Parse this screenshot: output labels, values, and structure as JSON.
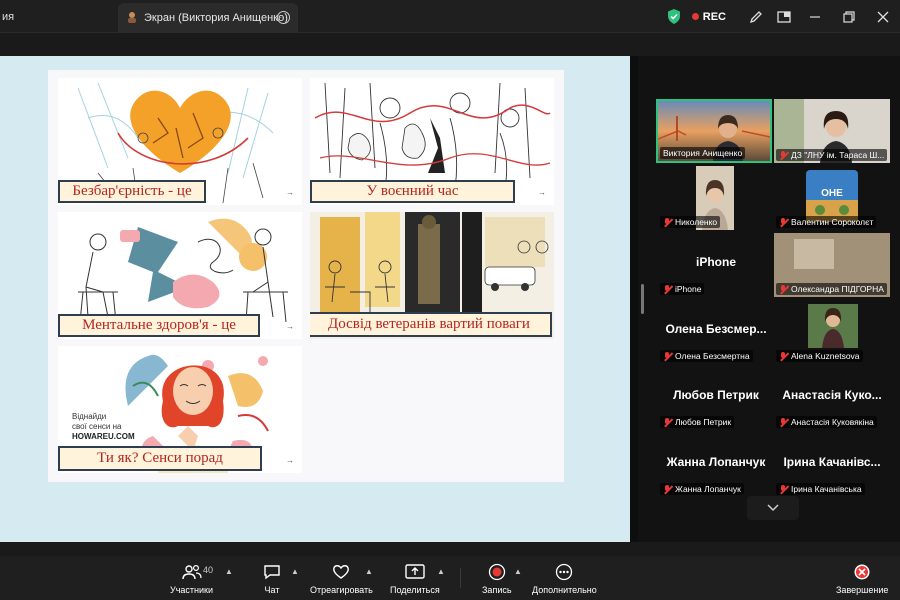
{
  "app": {
    "prev_tab_fragment": "ия",
    "active_tab_title": "Экран (Виктория Анищенко)",
    "rec_label": "REC"
  },
  "slide": {
    "cards": [
      {
        "label": "Безбар'єрність - це"
      },
      {
        "label": "У воєнний час"
      },
      {
        "label": "Ментальне здоров'я - це"
      },
      {
        "label": "Досвід ветеранів вартий поваги"
      },
      {
        "label": "Ти як? Сенси порад"
      }
    ],
    "howareu_line1": "Віднайди",
    "howareu_line2": "свої сенси на",
    "howareu_site": "HOWAREU.COM",
    "arrow": "→"
  },
  "participants": [
    {
      "tag": "Виктория Анищенко",
      "muted": false
    },
    {
      "tag": "ДЗ \"ЛНУ ім. Тараса Ш...",
      "muted": true
    },
    {
      "tag": "Николенко",
      "muted": true
    },
    {
      "tag": "Валентин Сороколєт",
      "muted": true
    },
    {
      "big": "iPhone",
      "tag": "iPhone",
      "muted": true
    },
    {
      "tag": "Олександра ПІДГОРНА",
      "muted": true
    },
    {
      "big": "Олена  Безсмер...",
      "tag": "Олена Безсмертна",
      "muted": true
    },
    {
      "tag": "Alena Kuznetsova",
      "muted": true
    },
    {
      "big": "Любов Петрик",
      "tag": "Любов Петрик",
      "muted": true
    },
    {
      "big": "Анастасія  Куко...",
      "tag": "Анастасія Куковякіна",
      "muted": true
    },
    {
      "big": "Жанна Лопанчук",
      "tag": "Жанна Лопанчук",
      "muted": true
    },
    {
      "big": "Ірина  Качанівс...",
      "tag": "Ірина Качанівська",
      "muted": true
    }
  ],
  "toolbar": {
    "participants_label": "Участники",
    "participants_count": "40",
    "chat_label": "Чат",
    "react_label": "Отреагировать",
    "share_label": "Поделиться",
    "record_label": "Запись",
    "more_label": "Дополнительно",
    "end_label": "Завершение"
  },
  "colors": {
    "accent_green": "#2ec27e",
    "mute_red": "#e53935",
    "slide_bg": "#d6ebf1",
    "label_text": "#b3261e"
  }
}
